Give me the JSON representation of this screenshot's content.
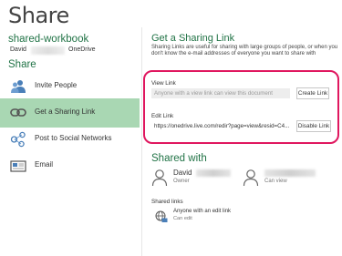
{
  "page": {
    "title": "Share"
  },
  "left": {
    "workbook_name": "shared-workbook",
    "owner": {
      "name": "David",
      "location": "OneDrive"
    },
    "section_title": "Share",
    "nav": [
      {
        "label": "Invite People",
        "icon": "people-icon"
      },
      {
        "label": "Get a Sharing Link",
        "icon": "link-icon",
        "active": true
      },
      {
        "label": "Post to Social Networks",
        "icon": "social-network-icon"
      },
      {
        "label": "Email",
        "icon": "email-icon"
      }
    ]
  },
  "sharing": {
    "title": "Get a Sharing Link",
    "description": "Sharing Links are useful for sharing with large groups of people, or when you don't know the e-mail addresses of everyone you want to share with",
    "view_label": "View Link",
    "view_placeholder": "Anyone with a view link can view this document",
    "create_button": "Create Link",
    "edit_label": "Edit Link",
    "edit_value": "https://onedrive.live.com/redir?page=view&resid=C4...",
    "disable_button": "Disable Link",
    "highlight_color": "#e0175f"
  },
  "shared_with": {
    "title": "Shared with",
    "people": [
      {
        "name": "David",
        "role": "Owner"
      },
      {
        "name": "",
        "role": "Can view"
      }
    ],
    "links_label": "Shared links",
    "link_entry": {
      "text": "Anyone with an edit link",
      "permission": "Can edit"
    }
  },
  "colors": {
    "accent": "#217346",
    "active_nav": "#a9d7b3"
  }
}
